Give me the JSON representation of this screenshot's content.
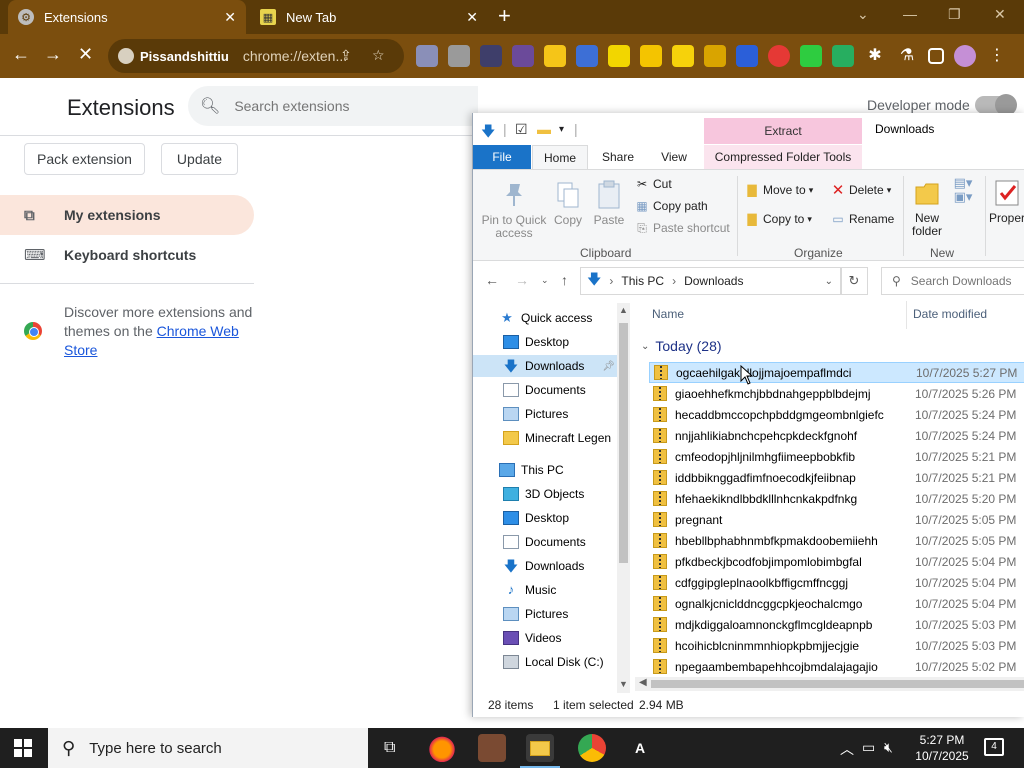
{
  "browser": {
    "tabs": [
      {
        "label": "Extensions",
        "active": true
      },
      {
        "label": "New Tab",
        "active": false
      }
    ],
    "new_tab": "+",
    "profile_name": "Pissandshittiu",
    "url": "chrome://exten..."
  },
  "extensions_page": {
    "title": "Extensions",
    "search_placeholder": "Search extensions",
    "developer_mode_label": "Developer mode",
    "developer_mode_on": true,
    "buttons": {
      "pack": "Pack extension",
      "update": "Update"
    },
    "sidebar": [
      {
        "label": "My extensions",
        "icon": "puzzle-icon",
        "selected": true
      },
      {
        "label": "Keyboard shortcuts",
        "icon": "keyboard-icon",
        "selected": false
      }
    ],
    "discover_text": "Discover more extensions and themes on the ",
    "discover_link": "Chrome Web Store"
  },
  "explorer": {
    "window_title": "Downloads",
    "context_tab": "Extract",
    "ribbon_tabs": [
      "File",
      "Home",
      "Share",
      "View",
      "Compressed Folder Tools"
    ],
    "ribbon": {
      "pin_to_quick_access": "Pin to Quick access",
      "copy": "Copy",
      "paste": "Paste",
      "cut": "Cut",
      "copy_path": "Copy path",
      "paste_shortcut": "Paste shortcut",
      "clipboard_group": "Clipboard",
      "move_to": "Move to",
      "copy_to": "Copy to",
      "delete": "Delete",
      "rename": "Rename",
      "organize_group": "Organize",
      "new_folder": "New folder",
      "new_group": "New",
      "properties": "Proper"
    },
    "address": {
      "root": "This PC",
      "folder": "Downloads"
    },
    "search_placeholder": "Search Downloads",
    "nav_pane": [
      {
        "label": "Quick access",
        "icon": "star-icon",
        "pinned": false
      },
      {
        "label": "Desktop",
        "icon": "desktop-icon",
        "pinned": true
      },
      {
        "label": "Downloads",
        "icon": "download-icon",
        "pinned": true,
        "selected": true
      },
      {
        "label": "Documents",
        "icon": "documents-icon",
        "pinned": true
      },
      {
        "label": "Pictures",
        "icon": "pictures-icon",
        "pinned": true
      },
      {
        "label": "Minecraft Legen",
        "icon": "folder-icon",
        "pinned": false
      },
      {
        "label": "This PC",
        "icon": "computer-icon",
        "pinned": false
      },
      {
        "label": "3D Objects",
        "icon": "3d-objects-icon",
        "pinned": false
      },
      {
        "label": "Desktop",
        "icon": "desktop-icon",
        "pinned": false
      },
      {
        "label": "Documents",
        "icon": "documents-icon",
        "pinned": false
      },
      {
        "label": "Downloads",
        "icon": "download-icon",
        "pinned": false
      },
      {
        "label": "Music",
        "icon": "music-icon",
        "pinned": false
      },
      {
        "label": "Pictures",
        "icon": "pictures-icon",
        "pinned": false
      },
      {
        "label": "Videos",
        "icon": "videos-icon",
        "pinned": false
      },
      {
        "label": "Local Disk (C:)",
        "icon": "disk-icon",
        "pinned": false
      }
    ],
    "columns": {
      "name": "Name",
      "date": "Date modified"
    },
    "group": "Today (28)",
    "files": [
      {
        "name": "ogcaehilgakbllojjmajoempaflmdci",
        "date": "10/7/2025 5:27 PM",
        "selected": true
      },
      {
        "name": "giaoehhefkmchjbbdnahgeppblbdejmj",
        "date": "10/7/2025 5:26 PM"
      },
      {
        "name": "hecaddbmccopchpbddgmgeombnlgiefc",
        "date": "10/7/2025 5:24 PM"
      },
      {
        "name": "nnjjahlikiabnchcpehcpkdeckfgnohf",
        "date": "10/7/2025 5:24 PM"
      },
      {
        "name": "cmfeodopjhljnilmhgfiimeepbobkfib",
        "date": "10/7/2025 5:21 PM"
      },
      {
        "name": "iddbbikn​ggadfimfnoecodkjfeiibnap",
        "date": "10/7/2025 5:21 PM"
      },
      {
        "name": "hfehaekiknd​lbbdklllnhcnkakpdfnkg",
        "date": "10/7/2025 5:20 PM"
      },
      {
        "name": "pregnant",
        "date": "10/7/2025 5:05 PM"
      },
      {
        "name": "hbebllbphabhnmbfkpmakdoobemiiehh",
        "date": "10/7/2025 5:05 PM"
      },
      {
        "name": "pfkdbeckjbcodfobjimpomlobimbgfal",
        "date": "10/7/2025 5:04 PM"
      },
      {
        "name": "cdfggipgleplnaoolkbffigcmffncggj",
        "date": "10/7/2025 5:04 PM"
      },
      {
        "name": "ognalkjcnicl​ddncggcpkjeochalcmgo",
        "date": "10/7/2025 5:04 PM"
      },
      {
        "name": "mdjkdiggaloamnonckgflmcgldeapnpb",
        "date": "10/7/2025 5:03 PM"
      },
      {
        "name": "hcoihicblcninmmnhiopkpbmjjecjgie",
        "date": "10/7/2025 5:03 PM"
      },
      {
        "name": "npegaambembapehhcojbmdalajagajio",
        "date": "10/7/2025 5:02 PM"
      }
    ],
    "status": {
      "items": "28 items",
      "selected": "1 item selected",
      "size": "2.94 MB"
    }
  },
  "taskbar": {
    "search_placeholder": "Type here to search",
    "time": "5:27 PM",
    "date": "10/7/2025",
    "notifications": "4"
  }
}
